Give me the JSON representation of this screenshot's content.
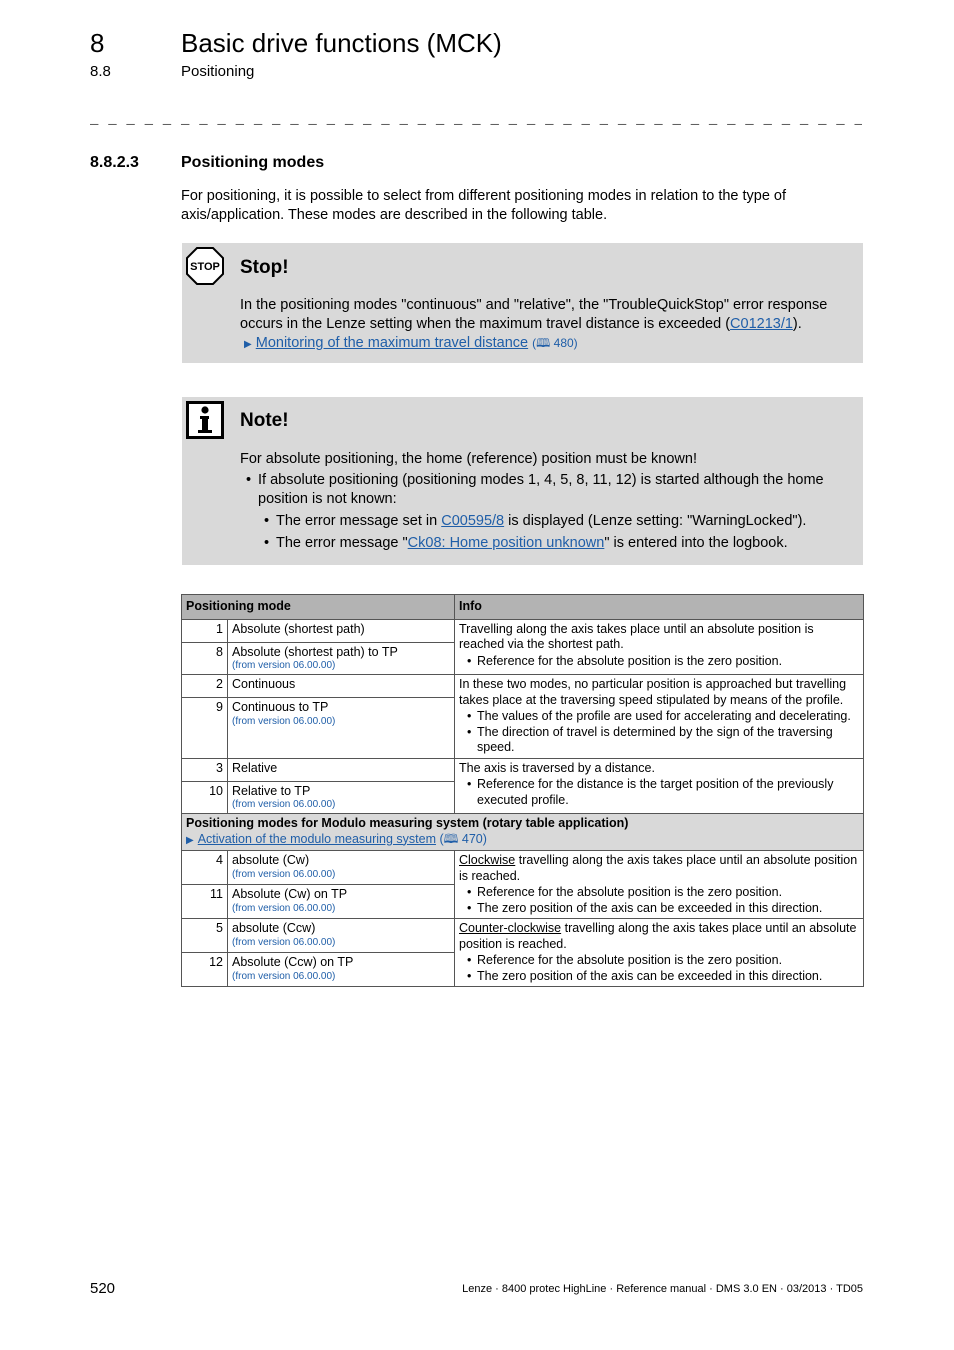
{
  "header": {
    "chapter_number": "8",
    "chapter_title": "Basic drive functions (MCK)",
    "section_number": "8.8",
    "section_title": "Positioning",
    "separator": "_ _ _ _ _ _ _ _ _ _ _ _ _ _ _ _ _ _ _ _ _ _ _ _ _ _ _ _ _ _ _ _ _ _ _ _ _ _ _ _ _ _ _ _ _ _ _ _ _ _ _ _ _ _ _ _ _ _ _ _ _ _ _ _ _"
  },
  "subsection": {
    "number": "8.8.2.3",
    "title": "Positioning modes",
    "intro": "For positioning, it is possible to select from different positioning modes in relation to the type of axis/application. These modes are described in the following table."
  },
  "stop_box": {
    "icon": "stop-sign-icon",
    "icon_text": "STOP",
    "heading": "Stop!",
    "text_before": "In the positioning modes \"continuous\" and \"relative\", the \"TroubleQuickStop\" error response occurs in the Lenze setting when the maximum travel distance is exceeded (",
    "code_link": "C01213/1",
    "text_after": ").",
    "xref_link": "Monitoring of the maximum travel distance",
    "xref_page": "(🕮 480)"
  },
  "note_box": {
    "icon": "info-icon",
    "heading": "Note!",
    "lead": "For absolute positioning, the home (reference) position must be known!",
    "bullet": "If absolute positioning (positioning modes 1, 4, 5, 8, 11, 12) is started although the home position is not known:",
    "sub1_before": "The error message set in ",
    "sub1_link": "C00595/8",
    "sub1_after": " is displayed (Lenze setting: \"WarningLocked\").",
    "sub2_before": "The error message \"",
    "sub2_link": "Ck08: Home position unknown",
    "sub2_after": "\" is entered into the logbook."
  },
  "table": {
    "headers": [
      "Positioning mode",
      "Info"
    ],
    "version_note": "(from version 06.00.00)",
    "rows": [
      {
        "num": "1",
        "name": "Absolute (shortest path)"
      },
      {
        "num": "8",
        "name": "Absolute (shortest path) to TP"
      },
      {
        "num": "2",
        "name": "Continuous"
      },
      {
        "num": "9",
        "name": "Continuous to TP"
      },
      {
        "num": "3",
        "name": "Relative"
      },
      {
        "num": "10",
        "name": "Relative to TP"
      },
      {
        "num": "4",
        "name": "absolute (Cw)"
      },
      {
        "num": "11",
        "name": "Absolute (Cw) on TP"
      },
      {
        "num": "5",
        "name": "absolute (Ccw)"
      },
      {
        "num": "12",
        "name": "Absolute (Ccw) on TP"
      }
    ],
    "info": {
      "absolute": {
        "text": "Travelling along the axis takes place until an absolute position is reached via the shortest path.",
        "bullets": [
          "Reference for the absolute position is the zero position."
        ]
      },
      "continuous": {
        "text": "In these two modes, no particular position is approached but travelling takes place at the traversing speed stipulated by means of the profile.",
        "bullets": [
          "The values of the profile are used for accelerating and decelerating.",
          "The direction of travel is determined by the sign of the traversing speed."
        ]
      },
      "relative": {
        "text": "The axis is traversed by a distance.",
        "bullets": [
          "Reference for the distance is the target position of the previously executed profile."
        ]
      },
      "cw": {
        "word": "Clockwise",
        "text": " travelling along the axis takes place until an absolute position is reached.",
        "bullets": [
          "Reference for the absolute position is the zero position.",
          "The zero position of the axis can be exceeded in this direction."
        ]
      },
      "ccw": {
        "word": "Counter-clockwise",
        "text": " travelling along the axis takes place until an absolute position is reached.",
        "bullets": [
          "Reference for the absolute position is the zero position.",
          "The zero position of the axis can be exceeded in this direction."
        ]
      }
    },
    "group": {
      "title": "Positioning modes for Modulo measuring system (rotary table application)",
      "link": "Activation of the modulo measuring system",
      "page": "470"
    }
  },
  "footer": {
    "page_number": "520",
    "doc_info": "Lenze · 8400 protec HighLine · Reference manual · DMS 3.0 EN · 03/2013 · TD05"
  }
}
